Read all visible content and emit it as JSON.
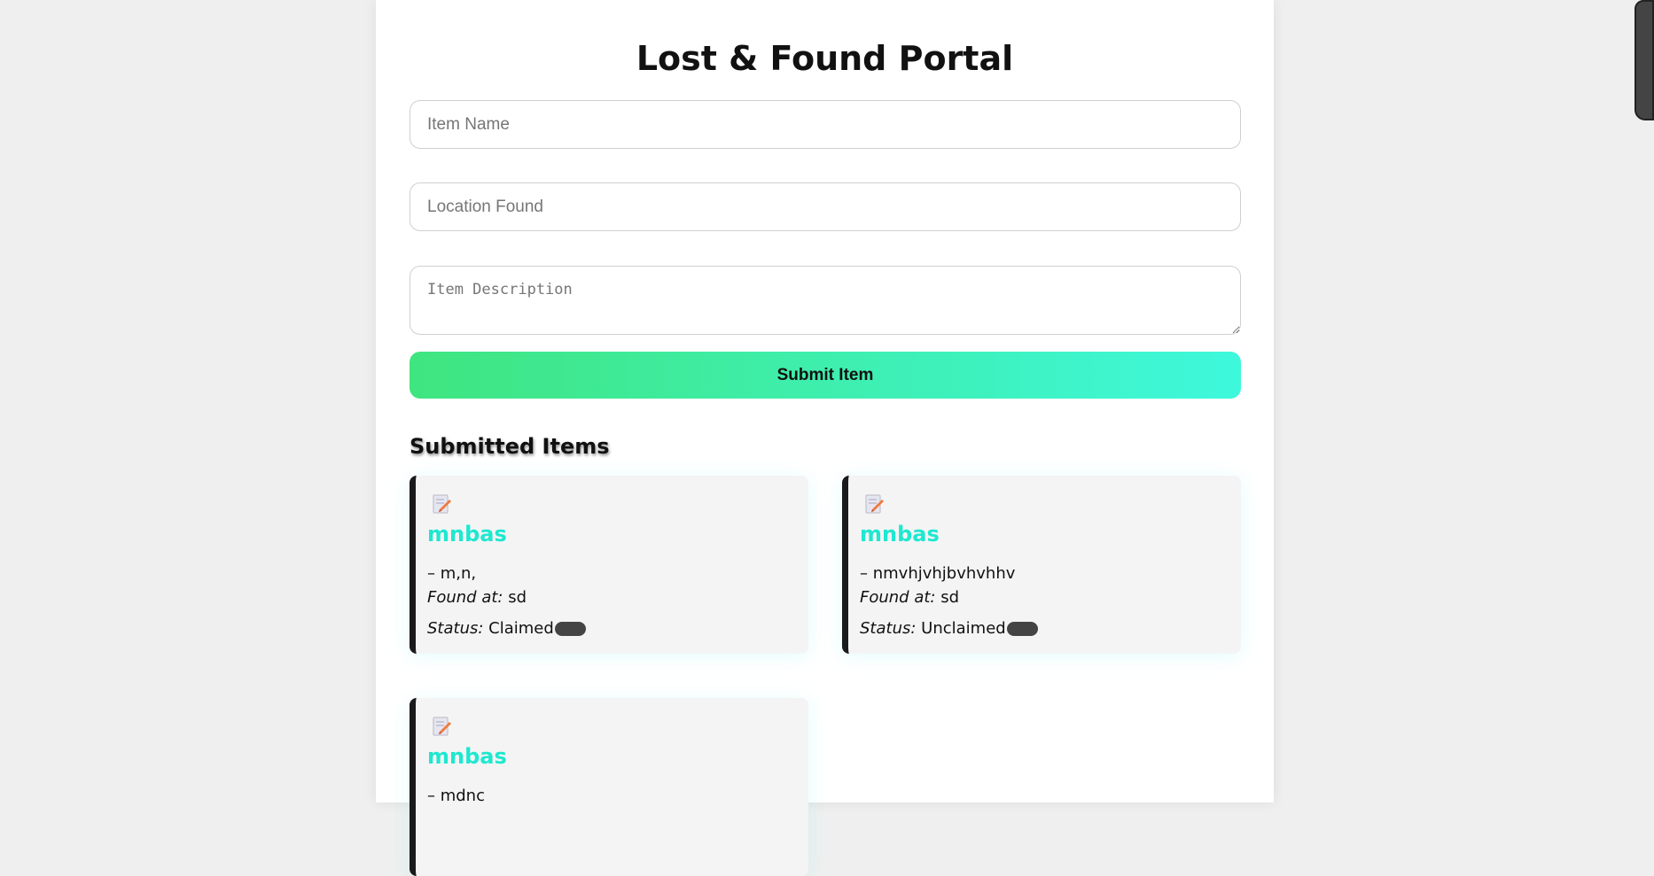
{
  "header": {
    "title": "Lost & Found Portal"
  },
  "form": {
    "item_name_placeholder": "Item Name",
    "location_placeholder": "Location Found",
    "description_placeholder": "Item Description",
    "submit_label": "Submit Item",
    "submit_gradient": [
      "#3fe57f",
      "#3ef8dc"
    ]
  },
  "items_section": {
    "heading": "Submitted Items",
    "found_label": "Found at:",
    "status_label": "Status:",
    "items": [
      {
        "icon": "memo-icon",
        "name": "mnbas",
        "description": "– m,n,",
        "location": "sd",
        "status": "Claimed"
      },
      {
        "icon": "memo-icon",
        "name": "mnbas",
        "description": "– nmvhjvhjbvhvhhv",
        "location": "sd",
        "status": "Unclaimed"
      },
      {
        "icon": "memo-icon",
        "name": "mnbas",
        "description": "– mdnc",
        "location": "",
        "status": ""
      }
    ]
  },
  "colors": {
    "accent_title": "#1ee8d0",
    "card_border": "#1a1a1a",
    "badge": "#444444"
  }
}
